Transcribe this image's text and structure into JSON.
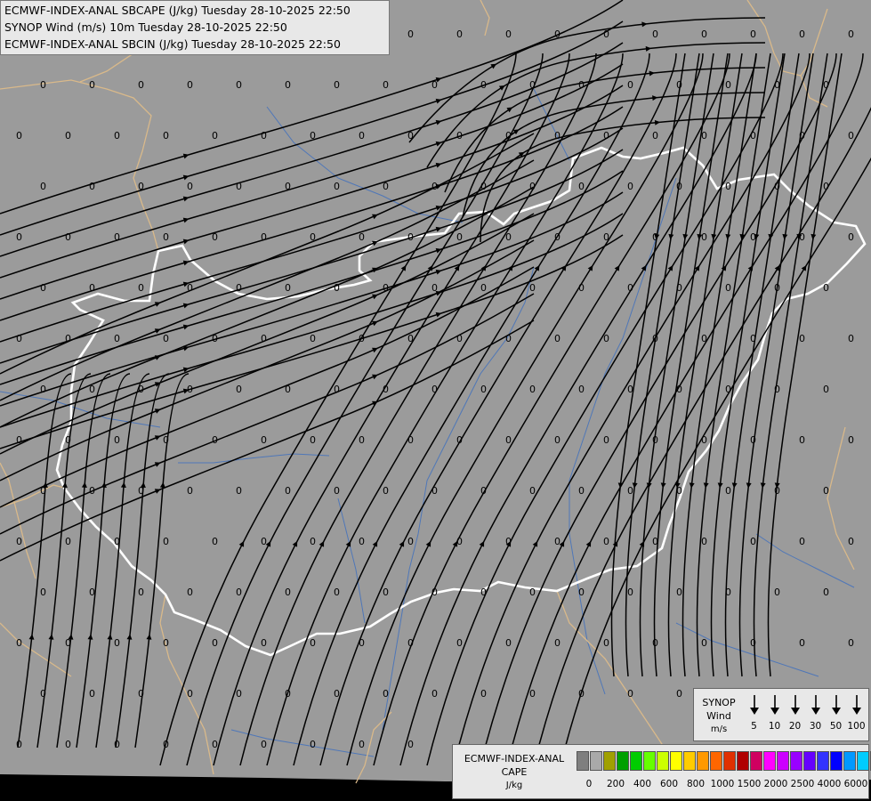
{
  "titles": [
    "ECMWF-INDEX-ANAL SBCAPE (J/kg) Tuesday 28-10-2025 22:50",
    "SYNOP Wind (m/s) 10m Tuesday 28-10-2025 22:50",
    "ECMWF-INDEX-ANAL SBCIN (J/kg) Tuesday 28-10-2025 22:50"
  ],
  "field_value_label": "0",
  "wind_legend": {
    "title_line1": "SYNOP",
    "title_line2": "Wind",
    "unit": "m/s",
    "speeds": [
      "5",
      "10",
      "20",
      "30",
      "50",
      "100"
    ]
  },
  "cape_legend": {
    "title_line1": "ECMWF-INDEX-ANAL",
    "title_line2": "CAPE",
    "unit": "J/kg",
    "colors": [
      "#7f7f7f",
      "#a9a9a9",
      "#a0a000",
      "#00a000",
      "#00cc00",
      "#66ff00",
      "#ccff00",
      "#ffff00",
      "#ffcc00",
      "#ff9900",
      "#ff6600",
      "#e03000",
      "#b00000",
      "#d00060",
      "#ff00ff",
      "#cc00ff",
      "#9900ff",
      "#6600ff",
      "#3333ff",
      "#0000ff",
      "#0099ff",
      "#00ccff",
      "#66ffff",
      "#ffffff"
    ],
    "labels": [
      "0",
      "200",
      "400",
      "600",
      "800",
      "1000",
      "1500",
      "2000",
      "2500",
      "4000",
      "6000"
    ]
  },
  "colors": {
    "background": "#9b9b9b",
    "streamline": "#000000",
    "country_border": "#ffffff",
    "neighbor_border": "#d9b98a",
    "rivers": "#4f77b8"
  }
}
